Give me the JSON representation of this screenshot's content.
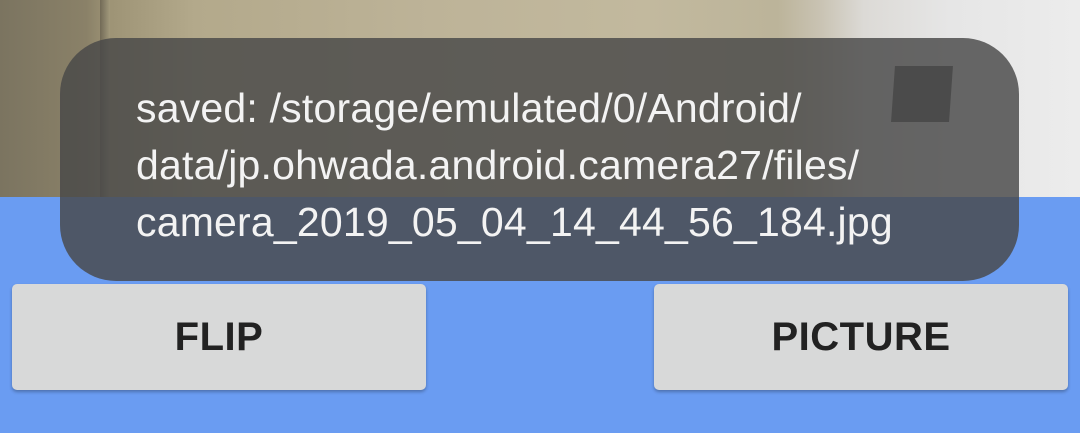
{
  "toast": {
    "message": "saved: /storage/emulated/0/Android/\ndata/jp.ohwada.android.camera27/files/\ncamera_2019_05_04_14_44_56_184.jpg"
  },
  "buttons": {
    "flip_label": "FLIP",
    "picture_label": "PICTURE"
  },
  "colors": {
    "background": "#6a9cf2",
    "button": "#d8d9d9",
    "toast": "#484848"
  }
}
